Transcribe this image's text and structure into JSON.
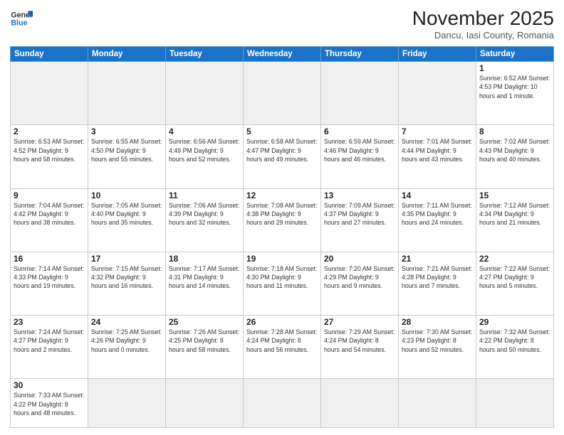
{
  "header": {
    "logo_general": "General",
    "logo_blue": "Blue",
    "title": "November 2025",
    "subtitle": "Dancu, Iasi County, Romania"
  },
  "weekdays": [
    "Sunday",
    "Monday",
    "Tuesday",
    "Wednesday",
    "Thursday",
    "Friday",
    "Saturday"
  ],
  "weeks": [
    [
      {
        "day": "",
        "info": "",
        "empty": true
      },
      {
        "day": "",
        "info": "",
        "empty": true
      },
      {
        "day": "",
        "info": "",
        "empty": true
      },
      {
        "day": "",
        "info": "",
        "empty": true
      },
      {
        "day": "",
        "info": "",
        "empty": true
      },
      {
        "day": "",
        "info": "",
        "empty": true
      },
      {
        "day": "1",
        "info": "Sunrise: 6:52 AM\nSunset: 4:53 PM\nDaylight: 10 hours\nand 1 minute.",
        "empty": false
      }
    ],
    [
      {
        "day": "2",
        "info": "Sunrise: 6:53 AM\nSunset: 4:52 PM\nDaylight: 9 hours\nand 58 minutes.",
        "empty": false
      },
      {
        "day": "3",
        "info": "Sunrise: 6:55 AM\nSunset: 4:50 PM\nDaylight: 9 hours\nand 55 minutes.",
        "empty": false
      },
      {
        "day": "4",
        "info": "Sunrise: 6:56 AM\nSunset: 4:49 PM\nDaylight: 9 hours\nand 52 minutes.",
        "empty": false
      },
      {
        "day": "5",
        "info": "Sunrise: 6:58 AM\nSunset: 4:47 PM\nDaylight: 9 hours\nand 49 minutes.",
        "empty": false
      },
      {
        "day": "6",
        "info": "Sunrise: 6:59 AM\nSunset: 4:46 PM\nDaylight: 9 hours\nand 46 minutes.",
        "empty": false
      },
      {
        "day": "7",
        "info": "Sunrise: 7:01 AM\nSunset: 4:44 PM\nDaylight: 9 hours\nand 43 minutes.",
        "empty": false
      },
      {
        "day": "8",
        "info": "Sunrise: 7:02 AM\nSunset: 4:43 PM\nDaylight: 9 hours\nand 40 minutes.",
        "empty": false
      }
    ],
    [
      {
        "day": "9",
        "info": "Sunrise: 7:04 AM\nSunset: 4:42 PM\nDaylight: 9 hours\nand 38 minutes.",
        "empty": false
      },
      {
        "day": "10",
        "info": "Sunrise: 7:05 AM\nSunset: 4:40 PM\nDaylight: 9 hours\nand 35 minutes.",
        "empty": false
      },
      {
        "day": "11",
        "info": "Sunrise: 7:06 AM\nSunset: 4:39 PM\nDaylight: 9 hours\nand 32 minutes.",
        "empty": false
      },
      {
        "day": "12",
        "info": "Sunrise: 7:08 AM\nSunset: 4:38 PM\nDaylight: 9 hours\nand 29 minutes.",
        "empty": false
      },
      {
        "day": "13",
        "info": "Sunrise: 7:09 AM\nSunset: 4:37 PM\nDaylight: 9 hours\nand 27 minutes.",
        "empty": false
      },
      {
        "day": "14",
        "info": "Sunrise: 7:11 AM\nSunset: 4:35 PM\nDaylight: 9 hours\nand 24 minutes.",
        "empty": false
      },
      {
        "day": "15",
        "info": "Sunrise: 7:12 AM\nSunset: 4:34 PM\nDaylight: 9 hours\nand 21 minutes.",
        "empty": false
      }
    ],
    [
      {
        "day": "16",
        "info": "Sunrise: 7:14 AM\nSunset: 4:33 PM\nDaylight: 9 hours\nand 19 minutes.",
        "empty": false
      },
      {
        "day": "17",
        "info": "Sunrise: 7:15 AM\nSunset: 4:32 PM\nDaylight: 9 hours\nand 16 minutes.",
        "empty": false
      },
      {
        "day": "18",
        "info": "Sunrise: 7:17 AM\nSunset: 4:31 PM\nDaylight: 9 hours\nand 14 minutes.",
        "empty": false
      },
      {
        "day": "19",
        "info": "Sunrise: 7:18 AM\nSunset: 4:30 PM\nDaylight: 9 hours\nand 11 minutes.",
        "empty": false
      },
      {
        "day": "20",
        "info": "Sunrise: 7:20 AM\nSunset: 4:29 PM\nDaylight: 9 hours\nand 9 minutes.",
        "empty": false
      },
      {
        "day": "21",
        "info": "Sunrise: 7:21 AM\nSunset: 4:28 PM\nDaylight: 9 hours\nand 7 minutes.",
        "empty": false
      },
      {
        "day": "22",
        "info": "Sunrise: 7:22 AM\nSunset: 4:27 PM\nDaylight: 9 hours\nand 5 minutes.",
        "empty": false
      }
    ],
    [
      {
        "day": "23",
        "info": "Sunrise: 7:24 AM\nSunset: 4:27 PM\nDaylight: 9 hours\nand 2 minutes.",
        "empty": false
      },
      {
        "day": "24",
        "info": "Sunrise: 7:25 AM\nSunset: 4:26 PM\nDaylight: 9 hours\nand 0 minutes.",
        "empty": false
      },
      {
        "day": "25",
        "info": "Sunrise: 7:26 AM\nSunset: 4:25 PM\nDaylight: 8 hours\nand 58 minutes.",
        "empty": false
      },
      {
        "day": "26",
        "info": "Sunrise: 7:28 AM\nSunset: 4:24 PM\nDaylight: 8 hours\nand 56 minutes.",
        "empty": false
      },
      {
        "day": "27",
        "info": "Sunrise: 7:29 AM\nSunset: 4:24 PM\nDaylight: 8 hours\nand 54 minutes.",
        "empty": false
      },
      {
        "day": "28",
        "info": "Sunrise: 7:30 AM\nSunset: 4:23 PM\nDaylight: 8 hours\nand 52 minutes.",
        "empty": false
      },
      {
        "day": "29",
        "info": "Sunrise: 7:32 AM\nSunset: 4:22 PM\nDaylight: 8 hours\nand 50 minutes.",
        "empty": false
      }
    ],
    [
      {
        "day": "30",
        "info": "Sunrise: 7:33 AM\nSunset: 4:22 PM\nDaylight: 8 hours\nand 48 minutes.",
        "empty": false
      },
      {
        "day": "",
        "info": "",
        "empty": true
      },
      {
        "day": "",
        "info": "",
        "empty": true
      },
      {
        "day": "",
        "info": "",
        "empty": true
      },
      {
        "day": "",
        "info": "",
        "empty": true
      },
      {
        "day": "",
        "info": "",
        "empty": true
      },
      {
        "day": "",
        "info": "",
        "empty": true
      }
    ]
  ]
}
